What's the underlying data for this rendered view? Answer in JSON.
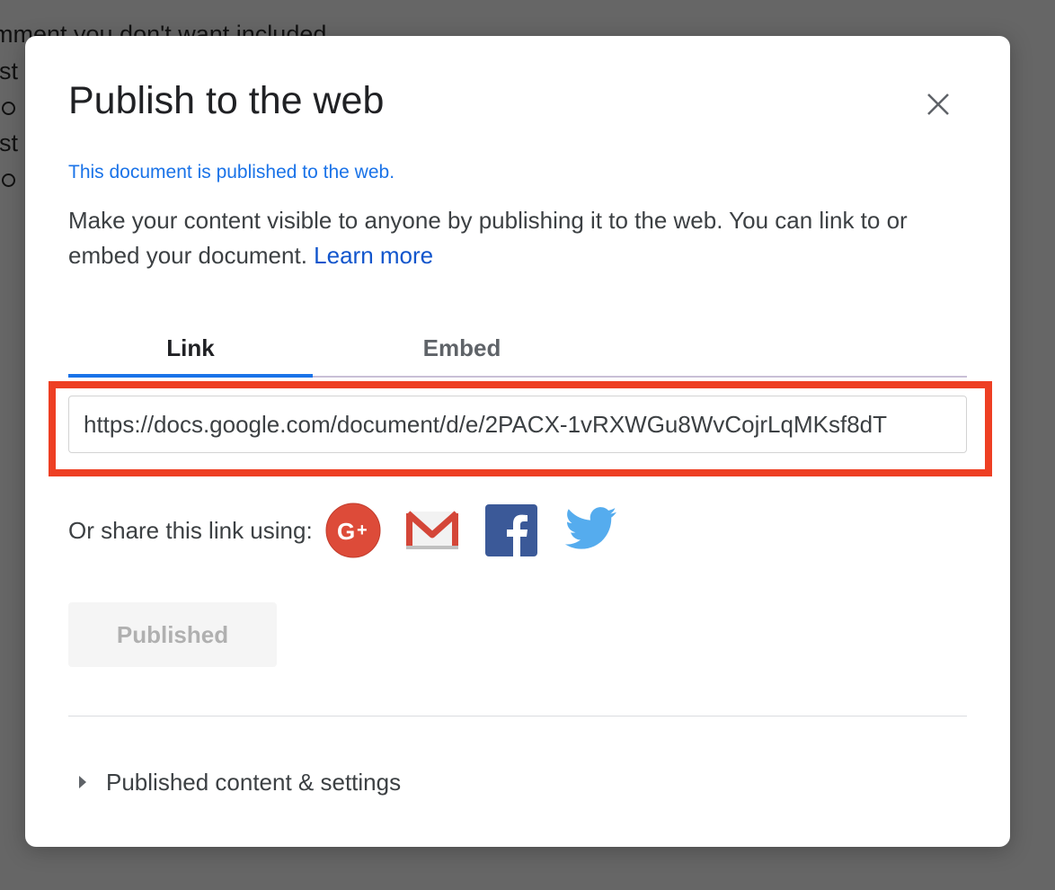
{
  "background": {
    "lines": [
      "mment you don't want included",
      "est",
      "",
      "est",
      ""
    ]
  },
  "dialog": {
    "title": "Publish to the web",
    "status": "This document is published to the web.",
    "description": "Make your content visible to anyone by publishing it to the web. You can link to or embed your document.",
    "learn_more_label": "Learn more",
    "tabs": [
      {
        "label": "Link",
        "active": true
      },
      {
        "label": "Embed",
        "active": false
      }
    ],
    "link_url": "https://docs.google.com/document/d/e/2PACX-1vRXWGu8WvCojrLqMKsf8dT",
    "share_label": "Or share this link using:",
    "share_icons": [
      "google-plus-icon",
      "gmail-icon",
      "facebook-icon",
      "twitter-icon"
    ],
    "published_button_label": "Published",
    "settings_label": "Published content & settings"
  },
  "colors": {
    "accent_blue": "#1a73e8",
    "link_blue": "#1155cc",
    "highlight_red": "#ee3f23",
    "overlay": "#666666"
  }
}
